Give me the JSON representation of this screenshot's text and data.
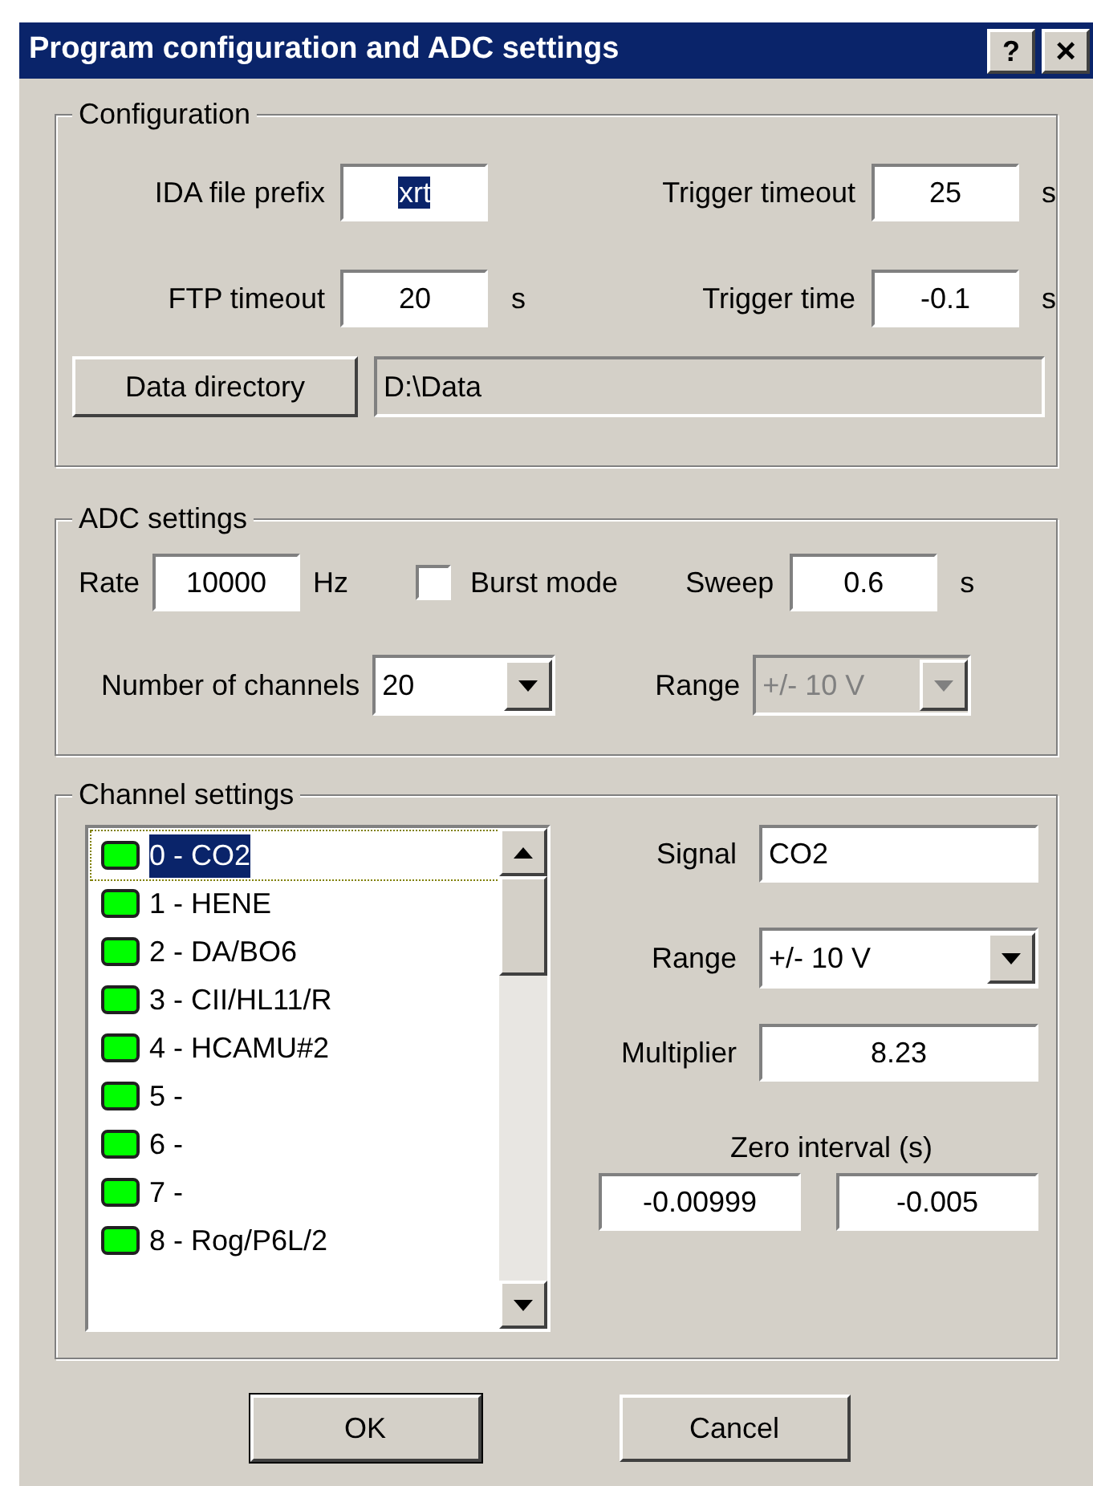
{
  "window": {
    "title": "Program configuration and ADC settings",
    "help_button": "?",
    "close_button": "×"
  },
  "configuration": {
    "title": "Configuration",
    "fields": [
      {
        "label": "IDA file prefix",
        "value": "xrt",
        "value_selected": true
      },
      {
        "label": "Trigger timeout",
        "value": "25",
        "unit": "s",
        "value_selected": false
      },
      {
        "label": "FTP timeout",
        "value": "20",
        "unit": "s",
        "value_selected": false
      },
      {
        "label": "Trigger time",
        "value": "-0.1",
        "unit": "s",
        "value_selected": false
      }
    ],
    "data_directory_button": "Data directory",
    "data_directory": "D:\\Data"
  },
  "adc": {
    "title": "ADC settings",
    "rate_label": "Rate",
    "rate": "10000",
    "rate_unit": "Hz",
    "burst_mode": {
      "label": "Burst mode",
      "checked": false
    },
    "sweep_label": "Sweep",
    "sweep": "0.6",
    "sweep_unit": "s",
    "channels_label": "Number of channels",
    "channels": "20",
    "range_label": "Range",
    "range": {
      "value": "+/- 10 V",
      "disabled": true
    }
  },
  "channel_settings": {
    "title": "Channel settings",
    "channels": [
      {
        "label": "0 - CO2",
        "on": true,
        "selected": true
      },
      {
        "label": "1 - HENE",
        "on": true,
        "selected": false
      },
      {
        "label": "2 - DA/BO6",
        "on": true,
        "selected": false
      },
      {
        "label": "3 - CII/HL11/R",
        "on": true,
        "selected": false
      },
      {
        "label": "4 - HCAMU#2",
        "on": true,
        "selected": false
      },
      {
        "label": "5 -",
        "on": true,
        "selected": false
      },
      {
        "label": "6 -",
        "on": true,
        "selected": false
      },
      {
        "label": "7 -",
        "on": true,
        "selected": false
      },
      {
        "label": "8 - Rog/P6L/2",
        "on": true,
        "selected": false
      }
    ],
    "signal_label": "Signal",
    "signal": "CO2",
    "range_label": "Range",
    "range": {
      "value": "+/- 10 V",
      "disabled": false
    },
    "multiplier_label": "Multiplier",
    "multiplier": "8.23",
    "zero_interval_label": "Zero interval (s)",
    "zero_from": "-0.00999",
    "zero_to": "-0.005"
  },
  "buttons": [
    {
      "label": "OK",
      "default": true
    },
    {
      "label": "Cancel",
      "default": false
    }
  ]
}
